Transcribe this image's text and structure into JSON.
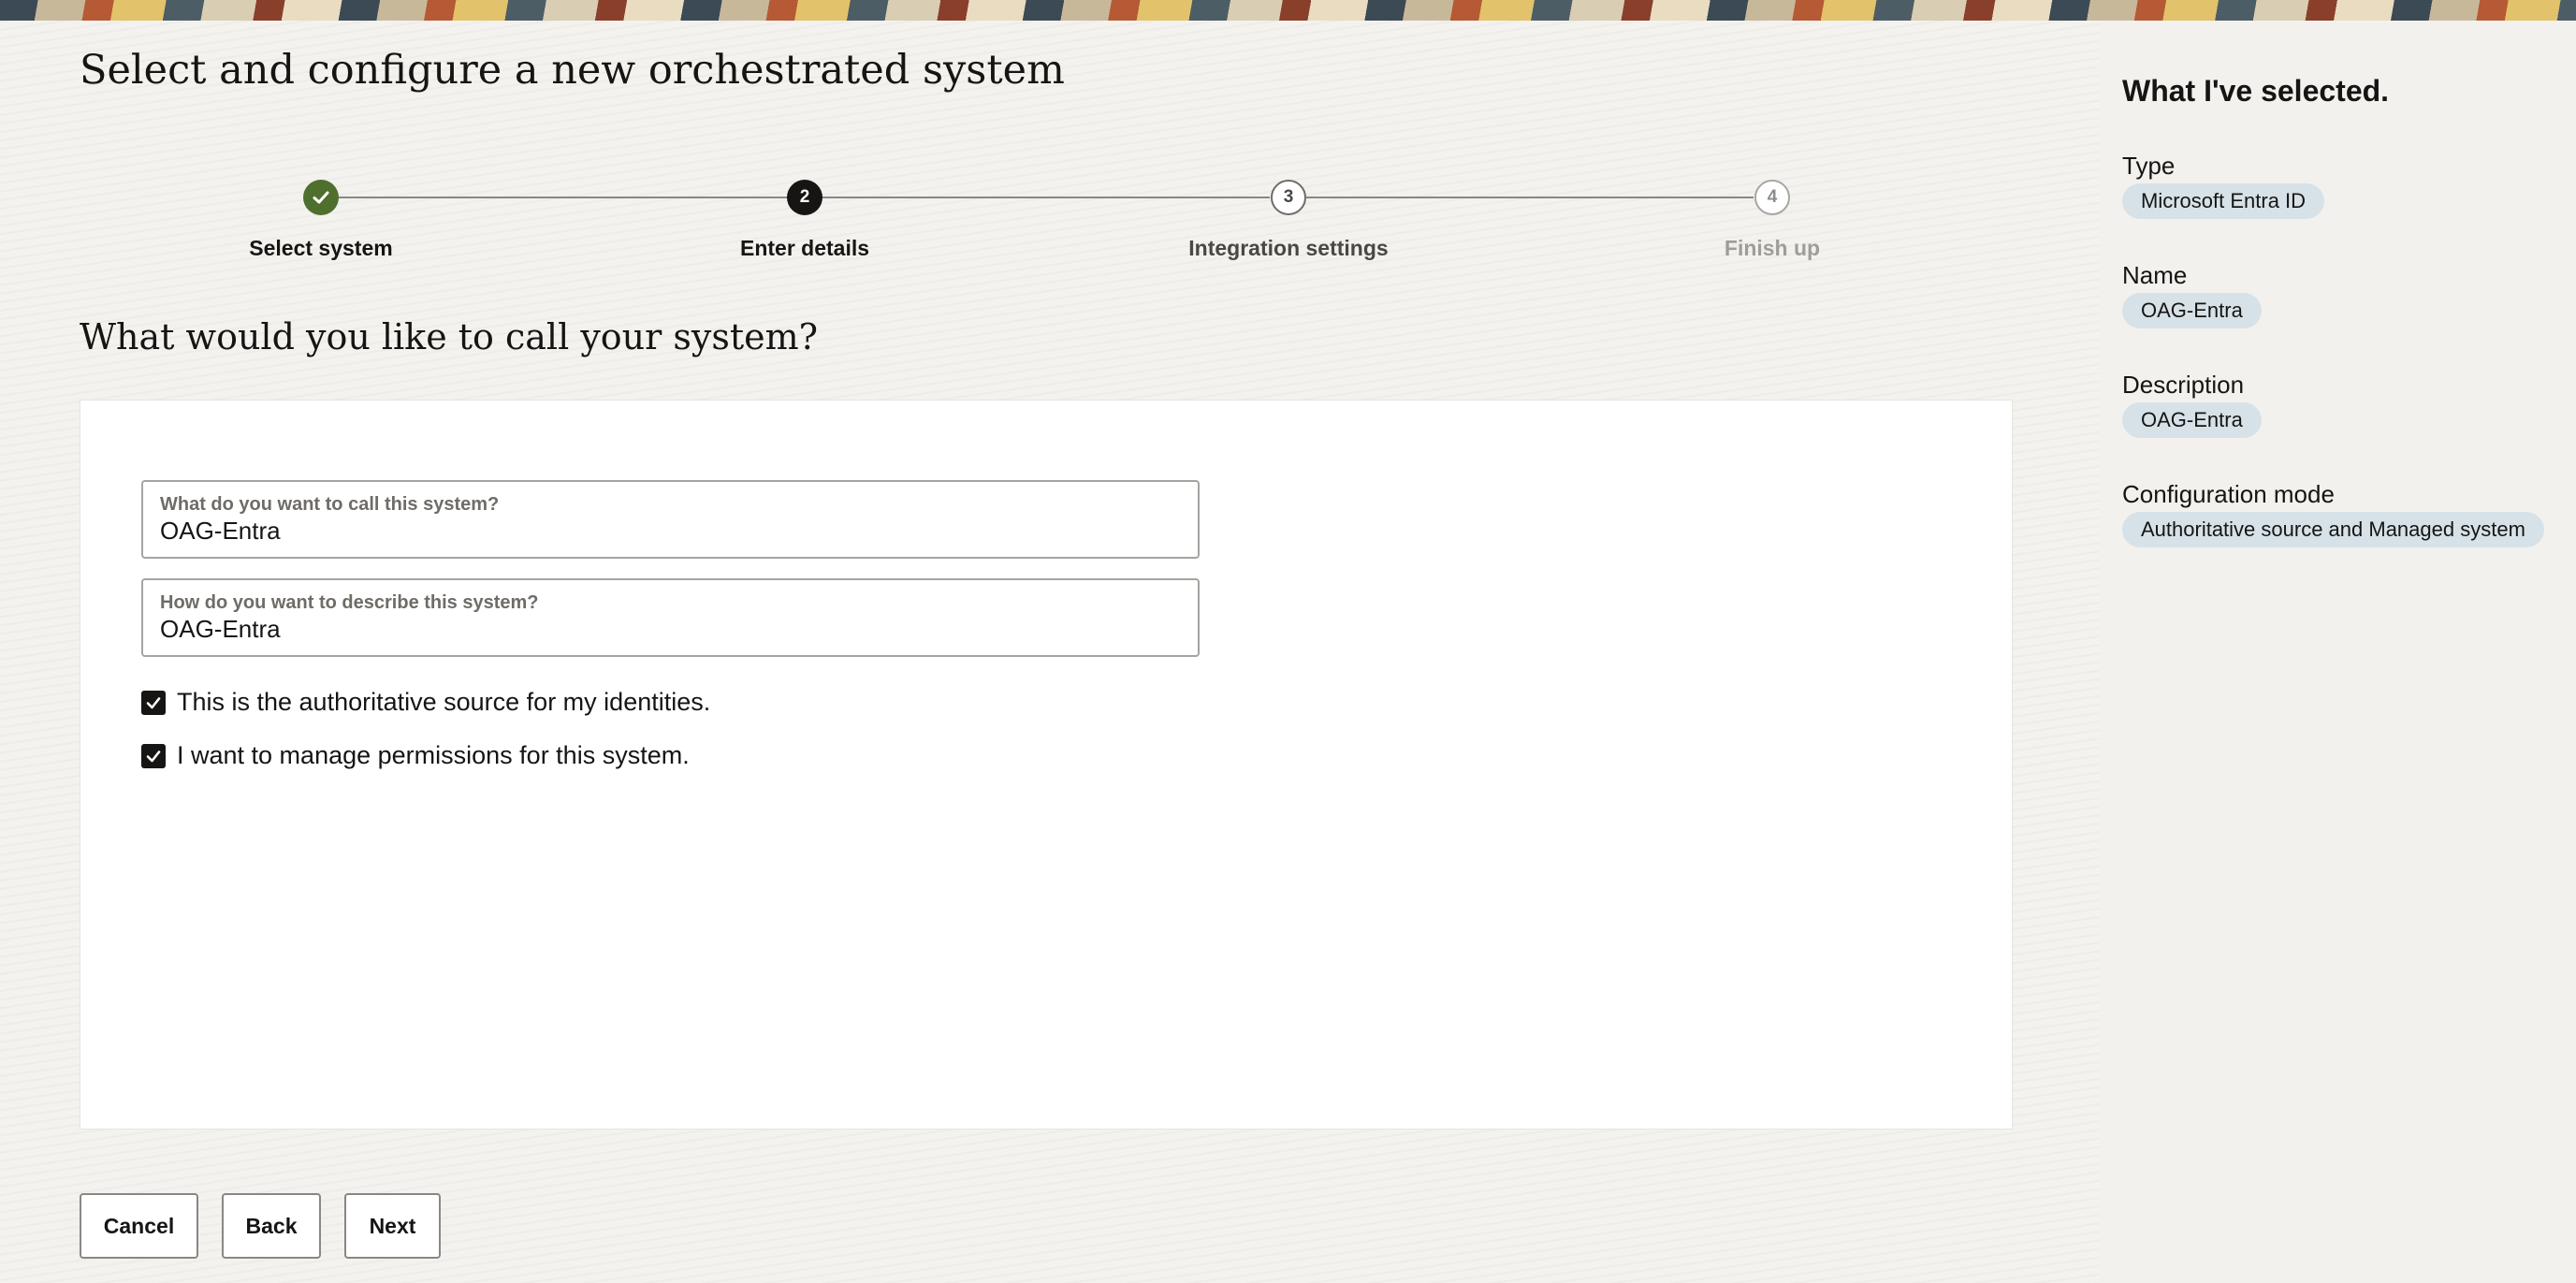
{
  "page": {
    "title": "Select and configure a new orchestrated system"
  },
  "stepper": {
    "steps": [
      {
        "number": "1",
        "label": "Select system",
        "state": "completed"
      },
      {
        "number": "2",
        "label": "Enter details",
        "state": "current"
      },
      {
        "number": "3",
        "label": "Integration settings",
        "state": "upcoming"
      },
      {
        "number": "4",
        "label": "Finish up",
        "state": "future"
      }
    ]
  },
  "form": {
    "section_title": "What would you like to call your system?",
    "name_field": {
      "label": "What do you want to call this system?",
      "value": "OAG-Entra"
    },
    "description_field": {
      "label": "How do you want to describe this system?",
      "value": "OAG-Entra"
    },
    "checkboxes": [
      {
        "label": "This is the authoritative source for my identities.",
        "checked": true
      },
      {
        "label": "I want to manage permissions for this system.",
        "checked": true
      }
    ]
  },
  "actions": {
    "cancel": "Cancel",
    "back": "Back",
    "next": "Next"
  },
  "summary": {
    "title": "What I've selected.",
    "items": [
      {
        "label": "Type",
        "value": "Microsoft Entra ID"
      },
      {
        "label": "Name",
        "value": "OAG-Entra"
      },
      {
        "label": "Description",
        "value": "OAG-Entra"
      },
      {
        "label": "Configuration mode",
        "value": "Authoritative source and Managed system"
      }
    ]
  },
  "colors": {
    "step_completed": "#4f6f2f",
    "step_current": "#161513",
    "chip_background": "#d7e2e8",
    "side_panel_background": "#f2f1ee"
  }
}
